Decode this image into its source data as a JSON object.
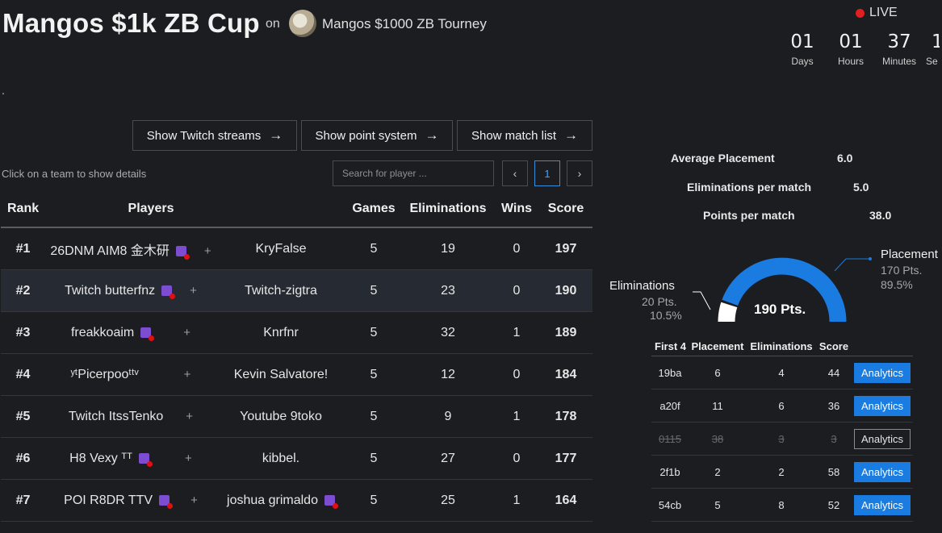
{
  "header": {
    "title": "Mangos $1k ZB Cup",
    "on_label": "on",
    "tourney_name": "Mangos $1000 ZB Tourney",
    "live_label": "LIVE",
    "dot": "."
  },
  "countdown": [
    {
      "num": "01",
      "label": "Days"
    },
    {
      "num": "01",
      "label": "Hours"
    },
    {
      "num": "37",
      "label": "Minutes"
    },
    {
      "num": "1",
      "label": "Se"
    }
  ],
  "buttons": {
    "twitch": "Show Twitch streams",
    "points": "Show point system",
    "matches": "Show match list",
    "arrow": "→"
  },
  "hint": "Click on a team to show details",
  "search": {
    "placeholder": "Search for player ..."
  },
  "pagination": {
    "prev": "‹",
    "page": "1",
    "next": "›"
  },
  "leaderboard": {
    "headers": {
      "rank": "Rank",
      "players": "Players",
      "games": "Games",
      "elims": "Eliminations",
      "wins": "Wins",
      "score": "Score"
    },
    "rows": [
      {
        "rank": "#1",
        "p1": "26DNM AIM8 金木研",
        "p2": "KryFalse",
        "games": "5",
        "elims": "19",
        "wins": "0",
        "score": "197"
      },
      {
        "rank": "#2",
        "p1": "Twitch butterfnz",
        "p2": "Twitch-zigtra",
        "games": "5",
        "elims": "23",
        "wins": "0",
        "score": "190"
      },
      {
        "rank": "#3",
        "p1": "freakkoaim",
        "p2": "Knrfnr",
        "games": "5",
        "elims": "32",
        "wins": "1",
        "score": "189"
      },
      {
        "rank": "#4",
        "p1": "ʸᵗPicerpooᵗᵗᵛ",
        "p2": "Kevin Salvatore!",
        "games": "5",
        "elims": "12",
        "wins": "0",
        "score": "184"
      },
      {
        "rank": "#5",
        "p1": "Twitch ItssTenko",
        "p2": "Youtube 9toko",
        "games": "5",
        "elims": "9",
        "wins": "1",
        "score": "178"
      },
      {
        "rank": "#6",
        "p1": "H8 Vexy ᵀᵀ",
        "p2": "kibbel.",
        "games": "5",
        "elims": "27",
        "wins": "0",
        "score": "177"
      },
      {
        "rank": "#7",
        "p1": "POI R8DR TTV",
        "p2": "joshua grimaldo",
        "games": "5",
        "elims": "25",
        "wins": "1",
        "score": "164"
      }
    ]
  },
  "team_stats": {
    "avg_label": "Average Placement",
    "avg_value": "6.0",
    "elim_label": "Eliminations per match",
    "elim_value": "5.0",
    "pts_label": "Points per match",
    "pts_value": "38.0"
  },
  "points_gauge": {
    "total": "190 Pts.",
    "elims_label": "Eliminations",
    "elims_pts": "20 Pts.",
    "elims_pct": "10.5%",
    "place_label": "Placement",
    "place_pts": "170 Pts.",
    "place_pct": "89.5%",
    "elims_fraction": 0.105,
    "colors": {
      "placement": "#1a7be0",
      "eliminations": "#ffffff"
    }
  },
  "matches": {
    "headers": {
      "first4": "First 4",
      "placement": "Placement",
      "elims": "Eliminations",
      "score": "Score"
    },
    "analytics_label": "Analytics",
    "rows": [
      {
        "first4": "19ba",
        "placement": "6",
        "elims": "4",
        "score": "44"
      },
      {
        "first4": "a20f",
        "placement": "11",
        "elims": "6",
        "score": "36"
      },
      {
        "first4": "0115",
        "placement": "38",
        "elims": "3",
        "score": "3"
      },
      {
        "first4": "2f1b",
        "placement": "2",
        "elims": "2",
        "score": "58"
      },
      {
        "first4": "54cb",
        "placement": "5",
        "elims": "8",
        "score": "52"
      }
    ]
  }
}
